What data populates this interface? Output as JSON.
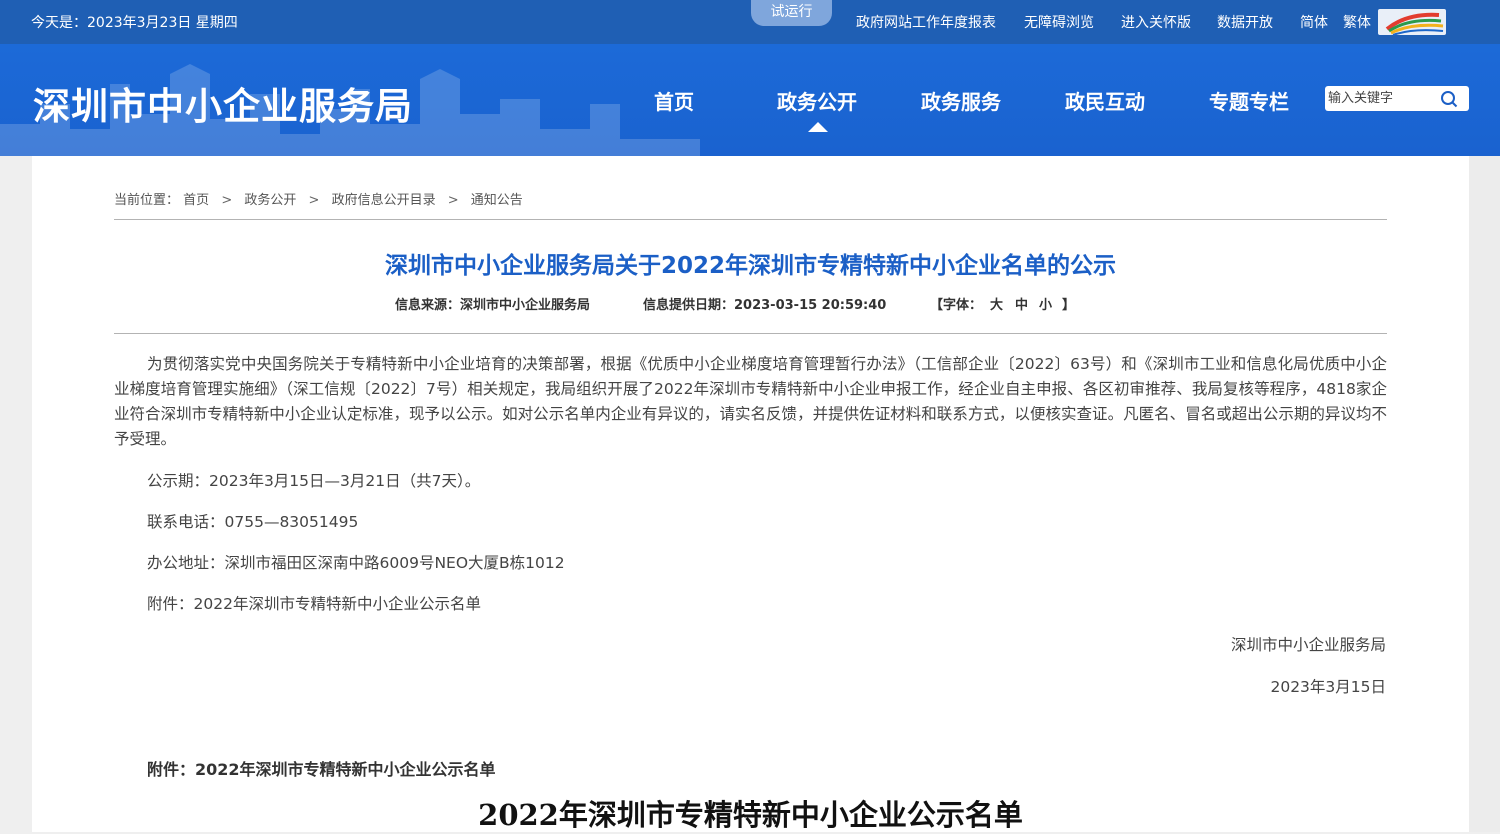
{
  "topbar": {
    "date": "今天是：2023年3月23日 星期四",
    "trial": "试运行",
    "links": [
      "政府网站工作年度报表",
      "无障碍浏览",
      "进入关怀版",
      "数据开放",
      "简体",
      "繁体"
    ]
  },
  "header": {
    "site_title": "深圳市中小企业服务局",
    "nav": [
      "首页",
      "政务公开",
      "政务服务",
      "政民互动",
      "专题专栏"
    ],
    "active_nav": "政务公开",
    "search_placeholder": "输入关键字"
  },
  "breadcrumb": {
    "prefix": "当前位置：",
    "items": [
      "首页",
      "政务公开",
      "政府信息公开目录",
      "通知公告"
    ],
    "separator": ">"
  },
  "article": {
    "title": "深圳市中小企业服务局关于2022年深圳市专精特新中小企业名单的公示",
    "source": "信息来源：深圳市中小企业服务局",
    "date": "信息提供日期：2023-03-15 20:59:40",
    "font_label": "【字体：",
    "font_large": "大",
    "font_medium": "中",
    "font_small": "小",
    "font_close": "】",
    "body": "为贯彻落实党中央国务院关于专精特新中小企业培育的决策部署，根据《优质中小企业梯度培育管理暂行办法》（工信部企业〔2022〕63号）和《深圳市工业和信息化局优质中小企业梯度培育管理实施细》（深工信规〔2022〕7号）相关规定，我局组织开展了2022年深圳市专精特新中小企业申报工作，经企业自主申报、各区初审推荐、我局复核等程序，4818家企业符合深圳市专精特新中小企业认定标准，现予以公示。如对公示名单内企业有异议的，请实名反馈，并提供佐证材料和联系方式，以便核实查证。凡匿名、冒名或超出公示期的异议均不予受理。",
    "period": "公示期：2023年3月15日—3月21日（共7天）。",
    "phone": "联系电话：0755—83051495",
    "address": "办公地址：深圳市福田区深南中路6009号NEO大厦B栋1012",
    "attachment": "附件：2022年深圳市专精特新中小企业公示名单",
    "signature_org": "深圳市中小企业服务局",
    "signature_date": "2023年3月15日",
    "attachment_heading": "附件：2022年深圳市专精特新中小企业公示名单",
    "list_title": "2022年深圳市专精特新中小企业公示名单"
  },
  "colors": {
    "topbar_bg": "#1f5fb4",
    "header_bg": "#1c6ad8",
    "title_blue": "#1b5fc6"
  },
  "icons": [
    "search-icon",
    "shenzhen-logo-icon"
  ]
}
